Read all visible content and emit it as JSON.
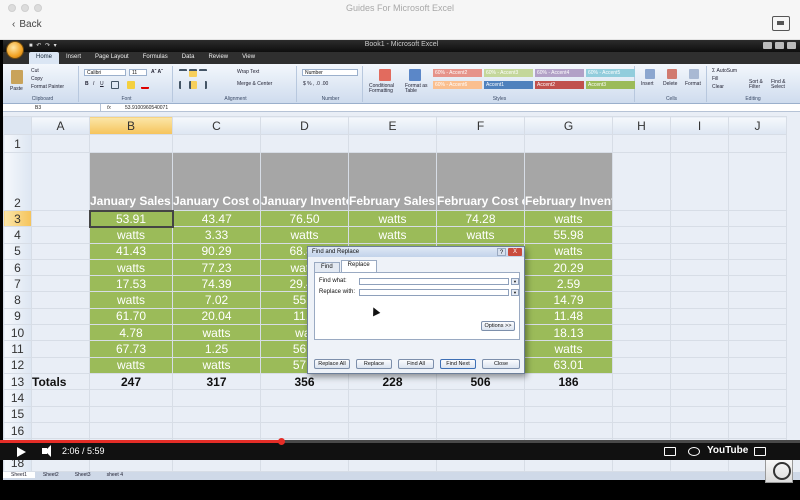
{
  "app": {
    "title": "Guides For Microsoft Excel",
    "back_label": "Back"
  },
  "excel": {
    "window_title": "Book1 - Microsoft Excel",
    "tabs": [
      "Home",
      "Insert",
      "Page Layout",
      "Formulas",
      "Data",
      "Review",
      "View"
    ],
    "ribbon": {
      "clipboard": {
        "paste": "Paste",
        "cut": "Cut",
        "copy": "Copy",
        "format_painter": "Format Painter",
        "label": "Clipboard"
      },
      "font": {
        "name": "Calibri",
        "size": "11",
        "label": "Font"
      },
      "alignment": {
        "wrap": "Wrap Text",
        "merge": "Merge & Center",
        "label": "Alignment"
      },
      "number": {
        "format": "Number",
        "label": "Number"
      },
      "styles": {
        "conditional": "Conditional Formatting",
        "format_table": "Format as Table",
        "chips": [
          {
            "text": "60% - Accent2",
            "color": "#e6938a"
          },
          {
            "text": "60% - Accent3",
            "color": "#c4d79b"
          },
          {
            "text": "60% - Accent4",
            "color": "#b2a1c7"
          },
          {
            "text": "60% - Accent5",
            "color": "#92cddc"
          },
          {
            "text": "60% - Accent6",
            "color": "#fabf8f"
          },
          {
            "text": "Accent1",
            "color": "#4f81bd"
          },
          {
            "text": "Accent2",
            "color": "#c0504d"
          },
          {
            "text": "Accent3",
            "color": "#9bbb59"
          }
        ],
        "label": "Styles"
      },
      "cells": {
        "insert": "Insert",
        "delete": "Delete",
        "format": "Format",
        "label": "Cells"
      },
      "editing": {
        "autosum": "AutoSum",
        "fill": "Fill",
        "clear": "Clear",
        "sort": "Sort & Filter",
        "find": "Find & Select",
        "label": "Editing"
      }
    },
    "name_box": "B3",
    "fx": "fx",
    "formula_value": "53.9100960540071",
    "columns": [
      "A",
      "B",
      "C",
      "D",
      "E",
      "F",
      "G",
      "H",
      "I",
      "J"
    ],
    "selected_column": "B",
    "selected_row": "3",
    "headers": [
      "January Sales Numbers",
      "January Cost of Goods Sold",
      "January Inventory on Hand",
      "February Sales Numbers",
      "February Cost of Goods Sold",
      "February Inventory on Hand"
    ],
    "rows": [
      {
        "n": "3",
        "v": [
          "53.91",
          "43.47",
          "76.50",
          "watts",
          "74.28",
          "watts"
        ]
      },
      {
        "n": "4",
        "v": [
          "watts",
          "3.33",
          "watts",
          "watts",
          "watts",
          "55.98"
        ]
      },
      {
        "n": "5",
        "v": [
          "41.43",
          "90.29",
          "68.89",
          "14.28",
          "90.81",
          "watts"
        ]
      },
      {
        "n": "6",
        "v": [
          "watts",
          "77.23",
          "watts",
          "20.81",
          "86.77",
          "20.29"
        ]
      },
      {
        "n": "7",
        "v": [
          "17.53",
          "74.39",
          "29.43",
          "12.38",
          "65.90",
          "2.59"
        ]
      },
      {
        "n": "8",
        "v": [
          "watts",
          "7.02",
          "55.7",
          "",
          "",
          "14.79"
        ]
      },
      {
        "n": "9",
        "v": [
          "61.70",
          "20.04",
          "11.4",
          "",
          "",
          "11.48"
        ]
      },
      {
        "n": "10",
        "v": [
          "4.78",
          "watts",
          "wat",
          "",
          "",
          "18.13"
        ]
      },
      {
        "n": "11",
        "v": [
          "67.73",
          "1.25",
          "56.2",
          "",
          "",
          "watts"
        ]
      },
      {
        "n": "12",
        "v": [
          "watts",
          "watts",
          "57.5",
          "",
          "",
          "63.01"
        ]
      }
    ],
    "totals_label": "Totals",
    "totals": [
      "247",
      "317",
      "356",
      "228",
      "506",
      "186"
    ],
    "empty_rows": [
      "14",
      "15",
      "16",
      "17",
      "18"
    ],
    "sheet_tabs": [
      "Sheet1",
      "Sheet2",
      "Sheet3",
      "sheet 4"
    ],
    "dialog": {
      "title": "Find and Replace",
      "tab_find": "Find",
      "tab_replace": "Replace",
      "find_label": "Find what:",
      "replace_label": "Replace with:",
      "options": "Options >>",
      "replace_all": "Replace All",
      "replace": "Replace",
      "find_all": "Find All",
      "find_next": "Find Next",
      "close": "Close",
      "help": "?",
      "x": "X"
    }
  },
  "player": {
    "time": "2:06 / 5:59",
    "progress": 0.351,
    "brand": "YouTube"
  }
}
